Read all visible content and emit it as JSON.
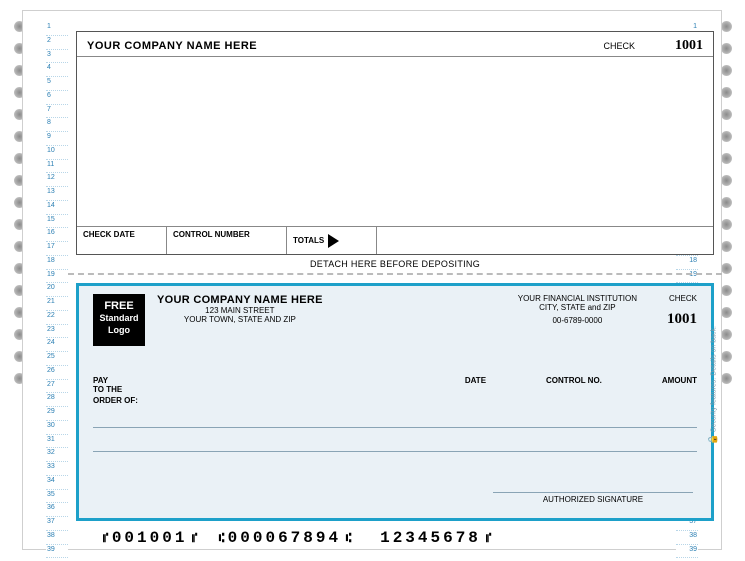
{
  "stub": {
    "company_name": "YOUR COMPANY NAME HERE",
    "check_label": "CHECK",
    "check_number": "1001",
    "check_date_label": "CHECK DATE",
    "control_number_label": "CONTROL NUMBER",
    "totals_label": "TOTALS"
  },
  "detach_text": "DETACH HERE BEFORE DEPOSITING",
  "check": {
    "logo": {
      "line1": "FREE",
      "line2": "Standard",
      "line3": "Logo"
    },
    "company_name": "YOUR COMPANY NAME HERE",
    "address1": "123 MAIN STREET",
    "address2": "YOUR TOWN, STATE AND ZIP",
    "bank_name": "YOUR FINANCIAL INSTITUTION",
    "bank_city": "CITY, STATE and ZIP",
    "bank_routing": "00-6789-0000",
    "check_label": "CHECK",
    "check_number": "1001",
    "pay_label": "PAY",
    "to_the_label": "TO THE",
    "order_of_label": "ORDER OF:",
    "date_label": "DATE",
    "control_no_label": "CONTROL NO.",
    "amount_label": "AMOUNT",
    "signature_label": "AUTHORIZED SIGNATURE",
    "security_text": "Security features. Details on back."
  },
  "micr": {
    "check_num": "001001",
    "routing": "000067894",
    "account": "12345678"
  },
  "ruler_marks": [
    "1",
    "2",
    "3",
    "4",
    "5",
    "6",
    "7",
    "8",
    "9",
    "10",
    "11",
    "12",
    "13",
    "14",
    "15",
    "16",
    "17",
    "18",
    "19",
    "20",
    "21",
    "22",
    "23",
    "24",
    "25",
    "26",
    "27",
    "28",
    "29",
    "30",
    "31",
    "32",
    "33",
    "34",
    "35",
    "36",
    "37",
    "38",
    "39"
  ]
}
